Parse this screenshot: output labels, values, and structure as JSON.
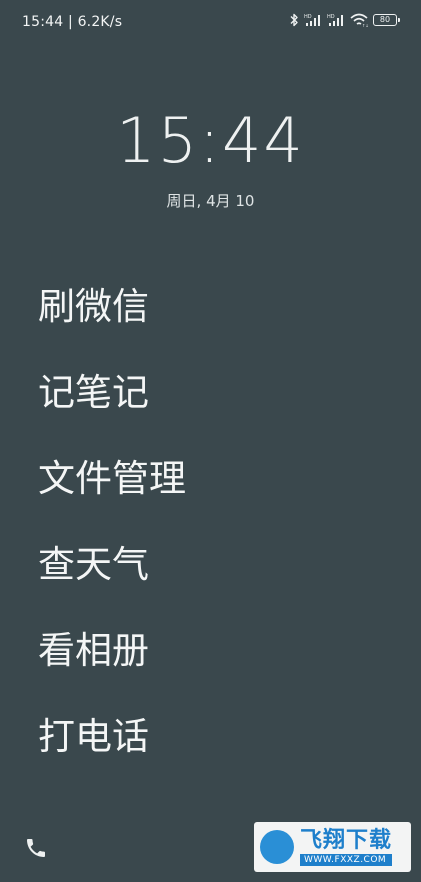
{
  "status_bar": {
    "time_speed": "15:44 | 6.2K/s",
    "battery_level": "80",
    "icons": [
      "bluetooth-icon",
      "signal-hd-icon",
      "signal-hd-icon",
      "wifi-icon",
      "battery-icon"
    ]
  },
  "clock": {
    "time": "15:44",
    "date": "周日, 4月 10"
  },
  "shortcuts": [
    {
      "label": "刷微信"
    },
    {
      "label": "记笔记"
    },
    {
      "label": "文件管理"
    },
    {
      "label": "查天气"
    },
    {
      "label": "看相册"
    },
    {
      "label": "打电话"
    }
  ],
  "bottom": {
    "left_icon": "phone-icon"
  },
  "watermark": {
    "name": "飞翔下载",
    "url": "WWW.FXXZ.COM"
  },
  "colors": {
    "background": "#3a484d",
    "text": "#eef1f1",
    "watermark_blue": "#1e7fcb"
  }
}
